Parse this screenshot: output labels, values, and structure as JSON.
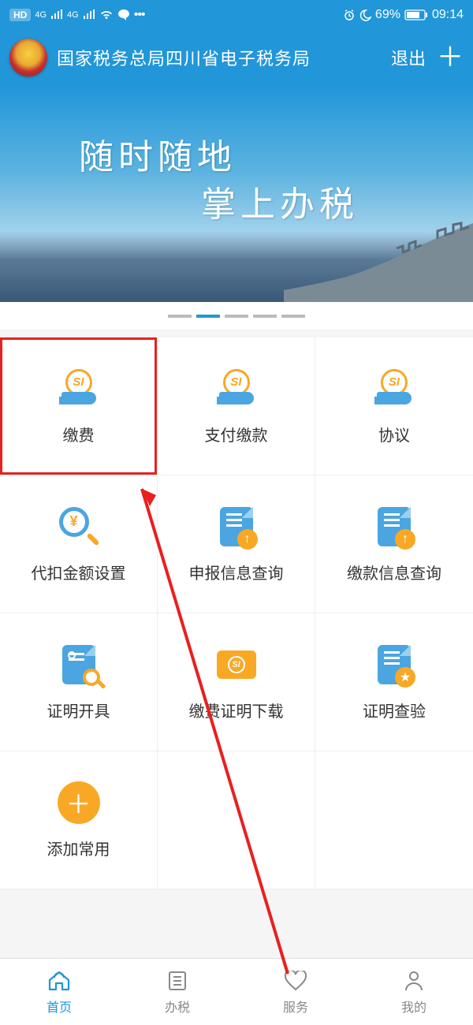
{
  "statusbar": {
    "hd": "HD",
    "four_g": "4G",
    "battery": "69%",
    "time": "09:14"
  },
  "header": {
    "title": "国家税务总局四川省电子税务局",
    "logout": "退出"
  },
  "banner": {
    "line1": "随时随地",
    "line2": "掌上办税"
  },
  "grid": {
    "items": [
      {
        "label": "缴费"
      },
      {
        "label": "支付缴款"
      },
      {
        "label": "协议"
      },
      {
        "label": "代扣金额设置"
      },
      {
        "label": "申报信息查询"
      },
      {
        "label": "缴款信息查询"
      },
      {
        "label": "证明开具"
      },
      {
        "label": "缴费证明下载"
      },
      {
        "label": "证明查验"
      },
      {
        "label": "添加常用"
      }
    ]
  },
  "nav": {
    "items": [
      {
        "label": "首页"
      },
      {
        "label": "办税"
      },
      {
        "label": "服务"
      },
      {
        "label": "我的"
      }
    ]
  },
  "carousel": {
    "active_index": 1,
    "count": 5
  },
  "colors": {
    "primary": "#2196d9",
    "accent": "#f9a825",
    "highlight": "#e82020"
  }
}
